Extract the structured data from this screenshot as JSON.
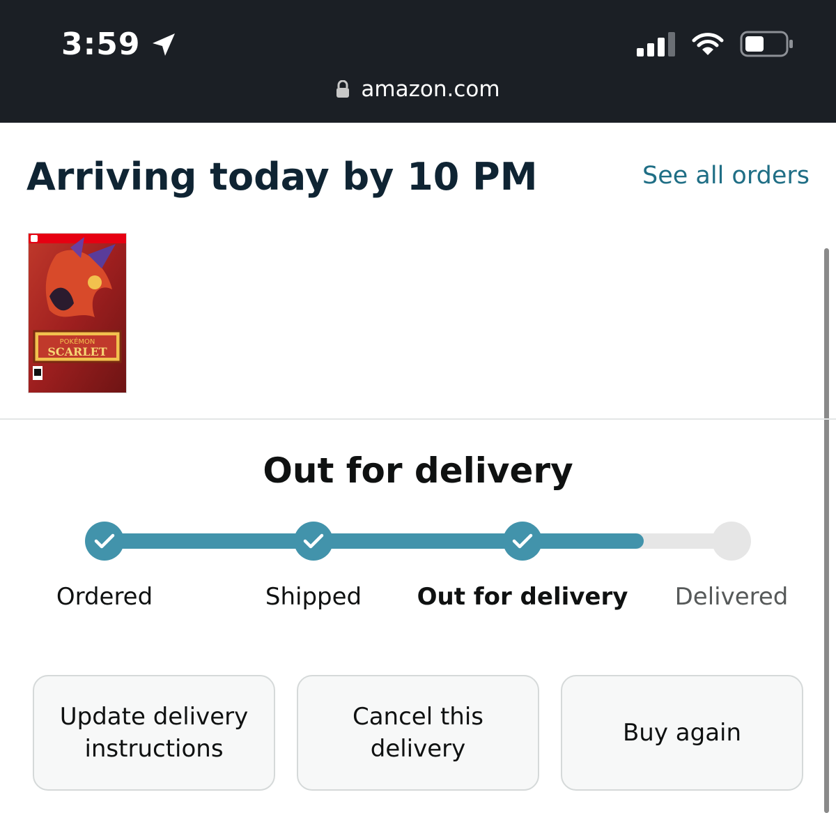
{
  "status_bar": {
    "time": "3:59",
    "url": "amazon.com",
    "icons": [
      "location-arrow-icon",
      "signal-icon",
      "wifi-icon",
      "battery-icon",
      "lock-icon"
    ]
  },
  "order": {
    "arrival_title": "Arriving today by 10 PM",
    "see_all_orders": "See all orders",
    "product_image_text": [
      "POKÉMON",
      "SCARLET"
    ]
  },
  "tracking": {
    "heading": "Out for delivery",
    "progress_fraction": 0.86,
    "steps": [
      {
        "label": "Ordered",
        "state": "done"
      },
      {
        "label": "Shipped",
        "state": "done"
      },
      {
        "label": "Out for delivery",
        "state": "current"
      },
      {
        "label": "Delivered",
        "state": "pending"
      }
    ]
  },
  "actions": {
    "update_delivery": "Update delivery instructions",
    "cancel_delivery": "Cancel this delivery",
    "buy_again": "Buy again"
  },
  "colors": {
    "status_bar_bg": "#1b1f25",
    "title_text": "#0f2433",
    "link": "#1f6e85",
    "progress_fill": "#4293ab",
    "progress_empty": "#e6e6e6",
    "button_bg": "#f7f8f8"
  }
}
